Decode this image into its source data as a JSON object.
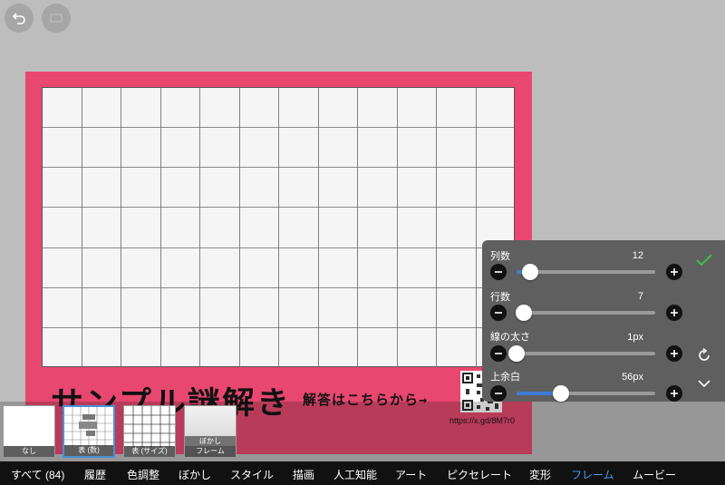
{
  "sample_text": {
    "title": "サンプル謎解き",
    "answer_prompt": "解答はこちらから→",
    "url": "https://x.gd/8M7r0"
  },
  "grid": {
    "columns": 12,
    "rows": 7
  },
  "presets": [
    {
      "label": "なし",
      "badge": ""
    },
    {
      "label": "表 (数)",
      "badge": ""
    },
    {
      "label": "表 (サイズ)",
      "badge": ""
    },
    {
      "label": "フレーム",
      "badge": "ぼかし"
    }
  ],
  "panel": {
    "columns": {
      "label": "列数",
      "value": "12",
      "level": 0.1
    },
    "rows": {
      "label": "行数",
      "value": "7",
      "level": 0.05
    },
    "line_width": {
      "label": "線の太さ",
      "value": "1px",
      "level": 0.0
    },
    "top_margin": {
      "label": "上余白",
      "value": "56px",
      "level": 0.32
    }
  },
  "tabs": [
    "すべて (84)",
    "履歴",
    "色調整",
    "ぼかし",
    "スタイル",
    "描画",
    "人工知能",
    "アート",
    "ピクセレート",
    "変形",
    "フレーム",
    "ムービー"
  ],
  "active_tab": "フレーム",
  "colors": {
    "frame": "#e8476f",
    "accent": "#3f7ad6",
    "confirm": "#3cc14a"
  }
}
